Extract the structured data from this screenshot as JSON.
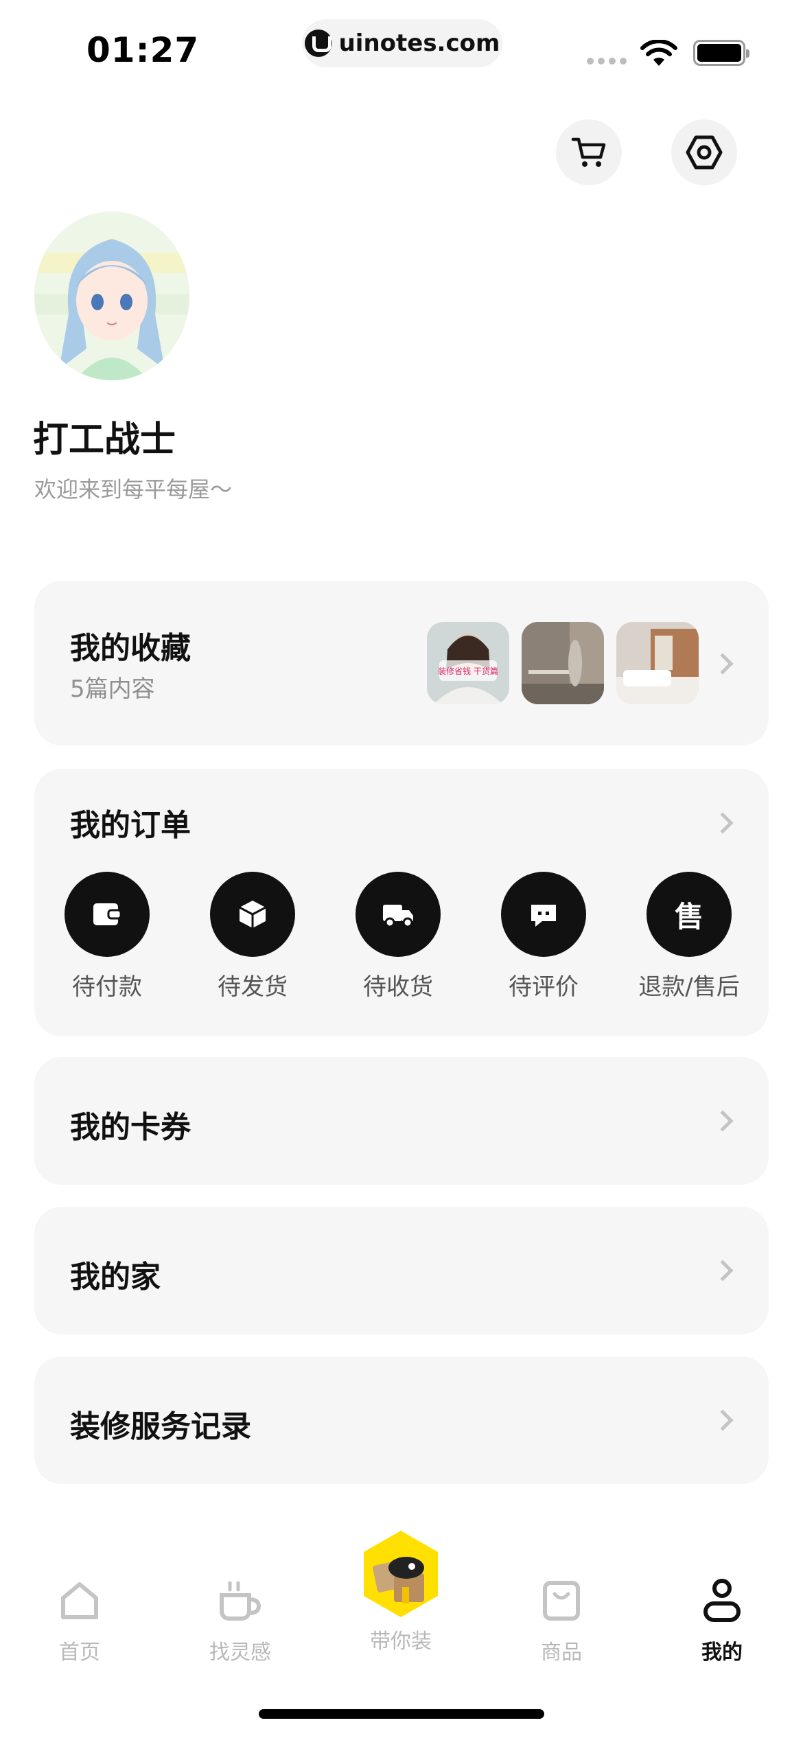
{
  "status_bar": {
    "time": "01:27",
    "url": "uinotes.com"
  },
  "header": {
    "cart_icon": "cart-icon",
    "settings_icon": "hexagon-settings-icon"
  },
  "profile": {
    "username": "打工战士",
    "welcome": "欢迎来到每平每屋～"
  },
  "favorites": {
    "title": "我的收藏",
    "count_text": "5篇内容",
    "thumb_caption": "装修省钱 干货篇"
  },
  "orders": {
    "title": "我的订单",
    "items": [
      {
        "label": "待付款",
        "icon": "wallet-icon"
      },
      {
        "label": "待发货",
        "icon": "box-icon"
      },
      {
        "label": "待收货",
        "icon": "truck-icon"
      },
      {
        "label": "待评价",
        "icon": "comment-icon"
      },
      {
        "label": "退款/售后",
        "icon": "after-sale-icon",
        "glyph": "售"
      }
    ]
  },
  "coupons": {
    "title": "我的卡券"
  },
  "my_home": {
    "title": "我的家"
  },
  "service_records": {
    "title": "装修服务记录"
  },
  "tab_bar": {
    "items": [
      {
        "label": "首页",
        "icon": "home-icon"
      },
      {
        "label": "找灵感",
        "icon": "cup-icon"
      },
      {
        "label": "带你装",
        "icon": "mascot-icon"
      },
      {
        "label": "商品",
        "icon": "bag-icon"
      },
      {
        "label": "我的",
        "icon": "person-icon",
        "active": true
      }
    ]
  },
  "colors": {
    "accent_yellow": "#FFE000",
    "card_bg": "#F6F6F6",
    "order_icon_bg": "#111111"
  }
}
